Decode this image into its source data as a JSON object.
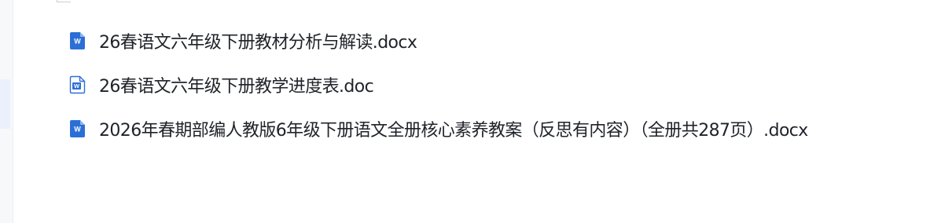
{
  "files": [
    {
      "name": "26春语文六年级下册教材分析与解读.docx",
      "icon": "word-docx-icon"
    },
    {
      "name": "26春语文六年级下册教学进度表.doc",
      "icon": "word-doc-icon"
    },
    {
      "name": "2026年春期部编人教版6年级下册语文全册核心素养教案（反思有内容）（全册共287页）.docx",
      "icon": "word-docx-icon"
    }
  ],
  "icon_letter": "W",
  "colors": {
    "word_blue": "#2b6fd6",
    "doc_outline": "#2b6fd6",
    "text": "#1f2329"
  }
}
